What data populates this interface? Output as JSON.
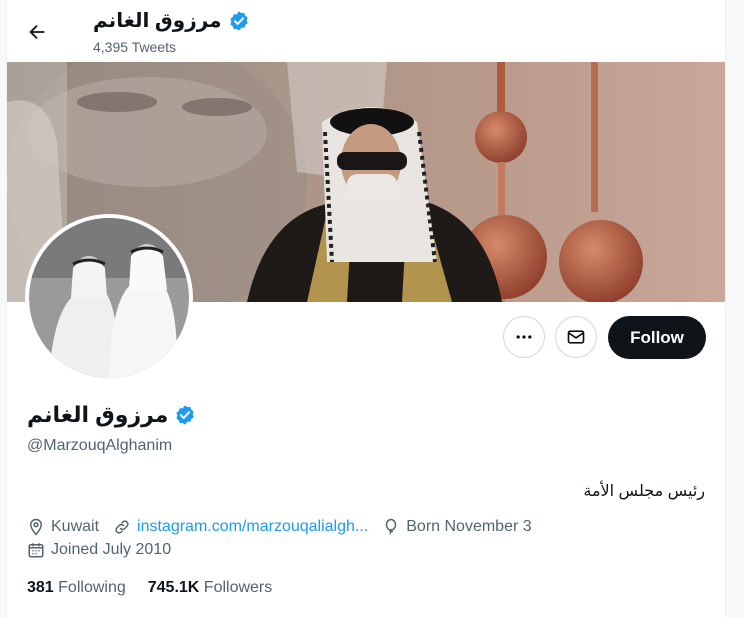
{
  "header": {
    "display_name": "مرزوق الغانم",
    "tweet_count": "4,395 Tweets",
    "back_icon": "arrow-left-icon"
  },
  "profile": {
    "display_name": "مرزوق الغانم",
    "handle": "@MarzouqAlghanim",
    "bio": "رئيس مجلس الأمة",
    "location": "Kuwait",
    "website": "instagram.com/marzouqalialgh...",
    "birthday": "Born November 3",
    "joined": "Joined July 2010",
    "verified_color": "#1d9bf0"
  },
  "actions": {
    "more_icon": "more-dots-icon",
    "message_icon": "envelope-icon",
    "follow_label": "Follow"
  },
  "stats": {
    "following_count": "381",
    "following_label": "Following",
    "followers_count": "745.1K",
    "followers_label": "Followers"
  },
  "colors": {
    "accent": "#1d9bf0",
    "text": "#0f1419",
    "muted": "#536471",
    "button": "#0f1419"
  }
}
